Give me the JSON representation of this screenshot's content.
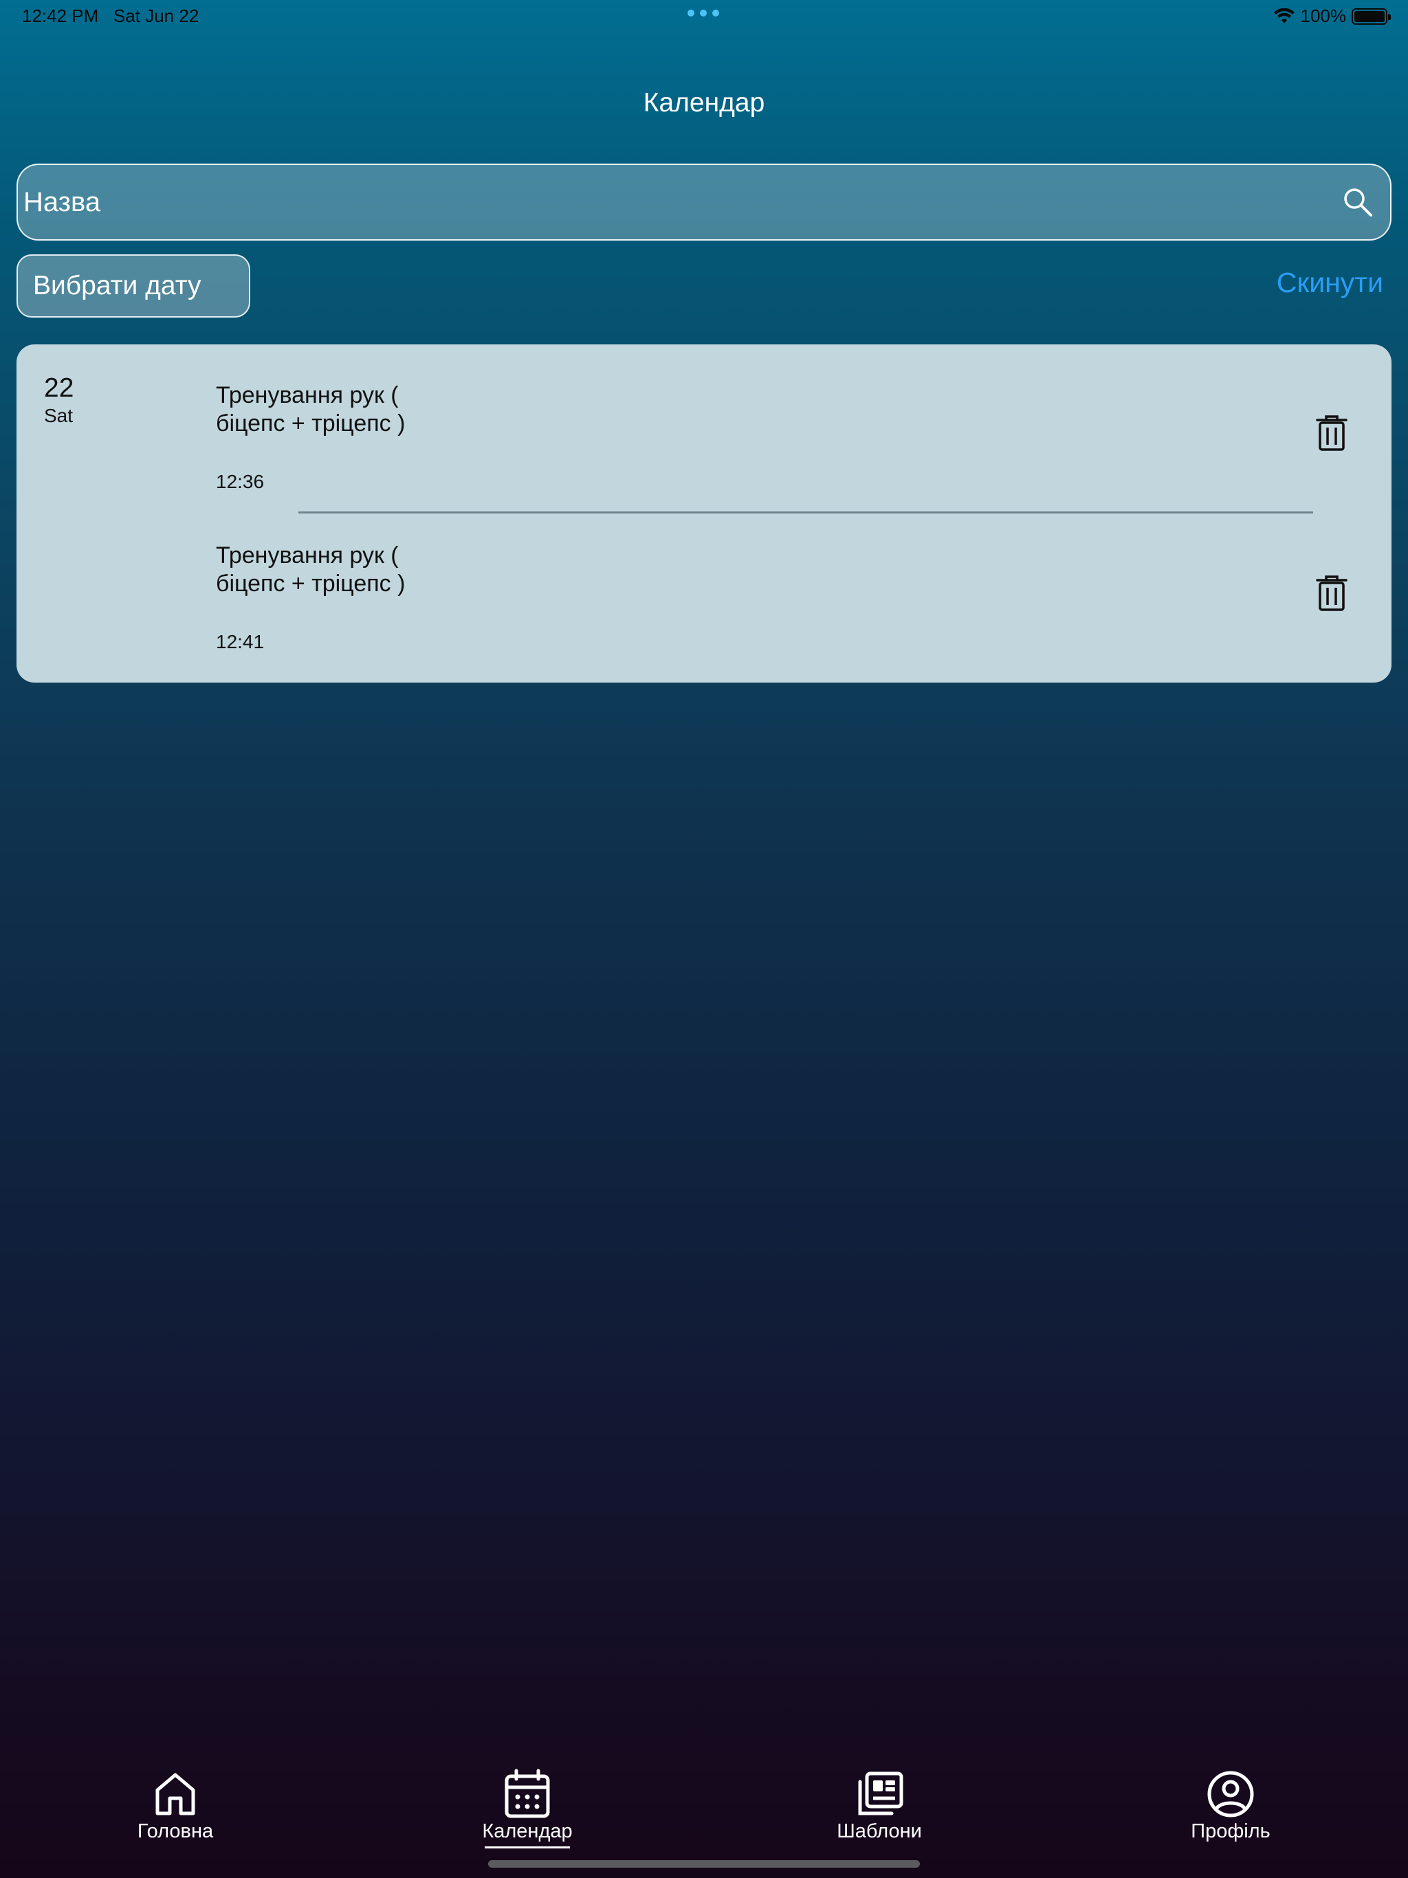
{
  "status_bar": {
    "time": "12:42 PM",
    "date": "Sat Jun 22",
    "battery": "100%"
  },
  "header": {
    "title": "Календар"
  },
  "search": {
    "placeholder": "Назва"
  },
  "filters": {
    "date_button_label": "Вибрати дату",
    "reset_label": "Скинути"
  },
  "day_group": {
    "day_number": "22",
    "day_name": "Sat",
    "entries": [
      {
        "title": "Тренування рук ( біцепс + тріцепс )",
        "time": "12:36"
      },
      {
        "title": "Тренування рук ( біцепс + тріцепс )",
        "time": "12:41"
      }
    ]
  },
  "tab_bar": {
    "tabs": [
      {
        "label": "Головна",
        "icon": "home-icon"
      },
      {
        "label": "Календар",
        "icon": "calendar-icon",
        "active": true
      },
      {
        "label": "Шаблони",
        "icon": "templates-icon"
      },
      {
        "label": "Профіль",
        "icon": "profile-icon"
      }
    ]
  },
  "colors": {
    "accent": "#2a9df4",
    "card": "#c2d6de",
    "gradient_top": "#026e92",
    "gradient_bottom": "#160619"
  }
}
